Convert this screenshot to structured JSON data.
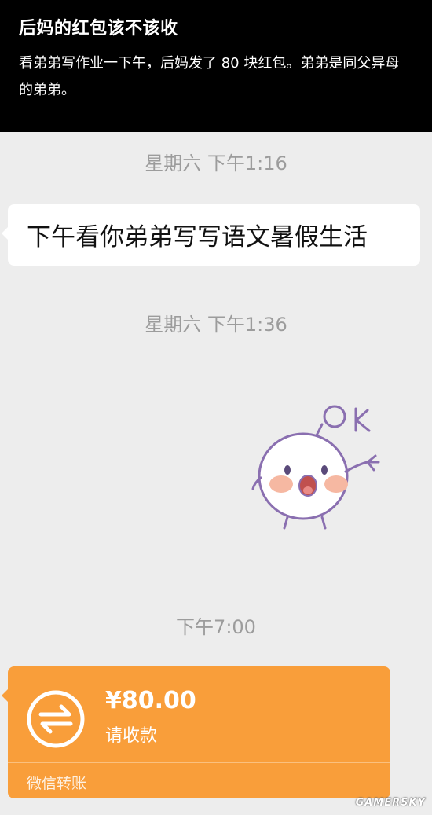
{
  "header": {
    "title": "后妈的红包该不该收",
    "description": "看弟弟写作业一下午，后妈发了 80 块红包。弟弟是同父异母的弟弟。"
  },
  "chat": {
    "timestamps": [
      "星期六 下午1:16",
      "星期六 下午1:36",
      "下午7:00"
    ],
    "message_text": "下午看你弟弟写写语文暑假生活",
    "sticker_text": "OK",
    "transfer": {
      "amount": "¥80.00",
      "status": "请收款",
      "footer": "微信转账"
    }
  },
  "watermark": "GAMERSKY",
  "colors": {
    "header_bg": "#000000",
    "chat_bg": "#ededed",
    "transfer_orange": "#f99e3a",
    "bubble_white": "#ffffff",
    "time_gray": "#9c9c9c",
    "sticker_line": "#8a6fb0",
    "sticker_cheek": "#f6b8a2"
  }
}
